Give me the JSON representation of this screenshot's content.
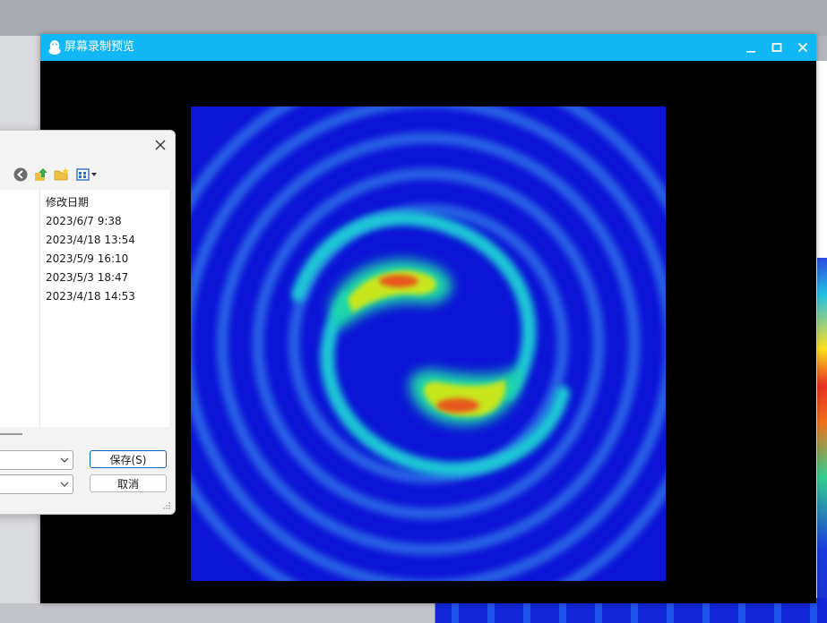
{
  "preview_window": {
    "title": "屏幕录制预览",
    "titlebar_color": "#12b7f5",
    "icons": [
      "penguin-icon",
      "minimize-icon",
      "maximize-icon",
      "close-icon"
    ]
  },
  "heatmap_colors": {
    "background": "#0c14d6",
    "ring": "#25c8d8",
    "mid": "#22d890",
    "high": "#f2e11a",
    "peak": "#e8561a"
  },
  "dialog": {
    "column_header": "修改日期",
    "dates": [
      "2023/6/7 9:38",
      "2023/4/18 13:54",
      "2023/5/9 16:10",
      "2023/5/3 18:47",
      "2023/4/18 14:53"
    ],
    "save_button": "保存(S)",
    "cancel_button": "取消",
    "icons": [
      "back-icon",
      "up-folder-icon",
      "new-folder-icon",
      "view-menu-icon"
    ]
  }
}
